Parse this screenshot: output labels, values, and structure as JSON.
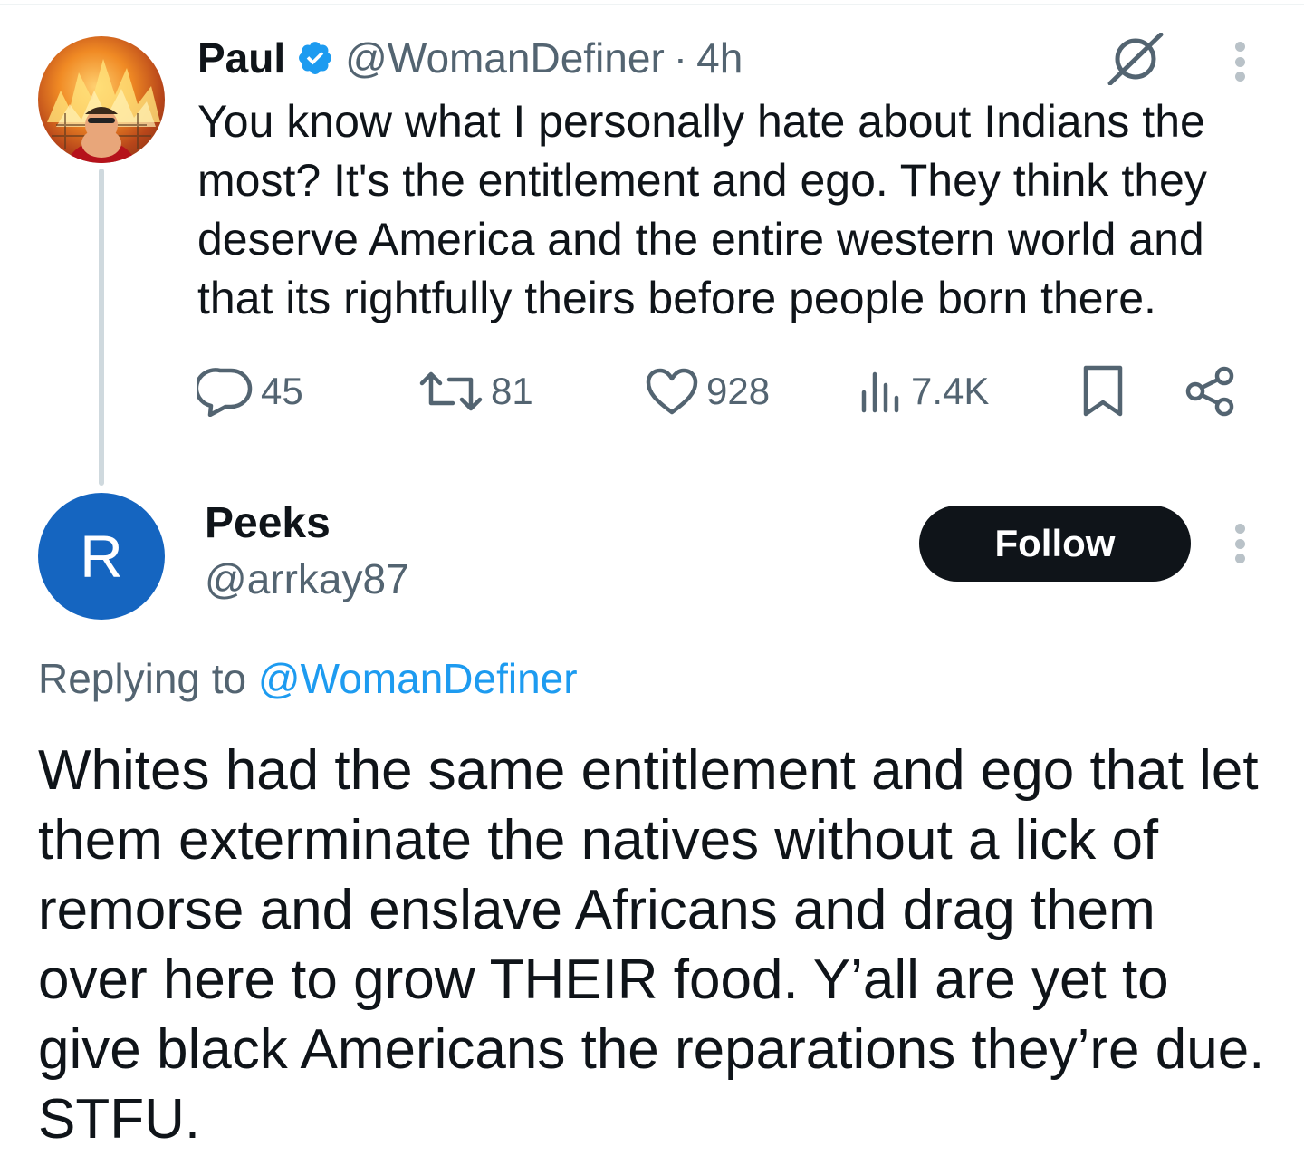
{
  "parent_tweet": {
    "author_name": "Paul",
    "handle": "@WomanDefiner",
    "separator": "·",
    "time": "4h",
    "text": "You know what I personally hate about Indians the most? It's the entitlement and ego. They think they deserve America and the entire western world and that its rightfully theirs before people born there.",
    "stats": {
      "replies": "45",
      "reposts": "81",
      "likes": "928",
      "views": "7.4K"
    },
    "icons": [
      "verified-badge-icon",
      "grok-icon",
      "more-icon",
      "reply-icon",
      "repost-icon",
      "like-icon",
      "views-icon",
      "bookmark-icon",
      "share-icon"
    ]
  },
  "reply_tweet": {
    "author_name": "Peeks",
    "handle": "@arrkay87",
    "avatar_letter": "R",
    "follow_label": "Follow",
    "replying_to_prefix": "Replying to",
    "replying_to_handle": "@WomanDefiner",
    "text": "Whites had the same entitlement and ego that let them exterminate the natives without a lick of remorse and enslave Africans and drag them over here to grow THEIR food. Y’all are yet to give black Americans the reparations they’re due. STFU."
  },
  "colors": {
    "text_primary": "#0f1419",
    "text_secondary": "#536471",
    "link": "#1d9bf0",
    "verified": "#1d9bf0",
    "follow_bg": "#0f1419",
    "reply_avatar_bg": "#1565c0"
  }
}
